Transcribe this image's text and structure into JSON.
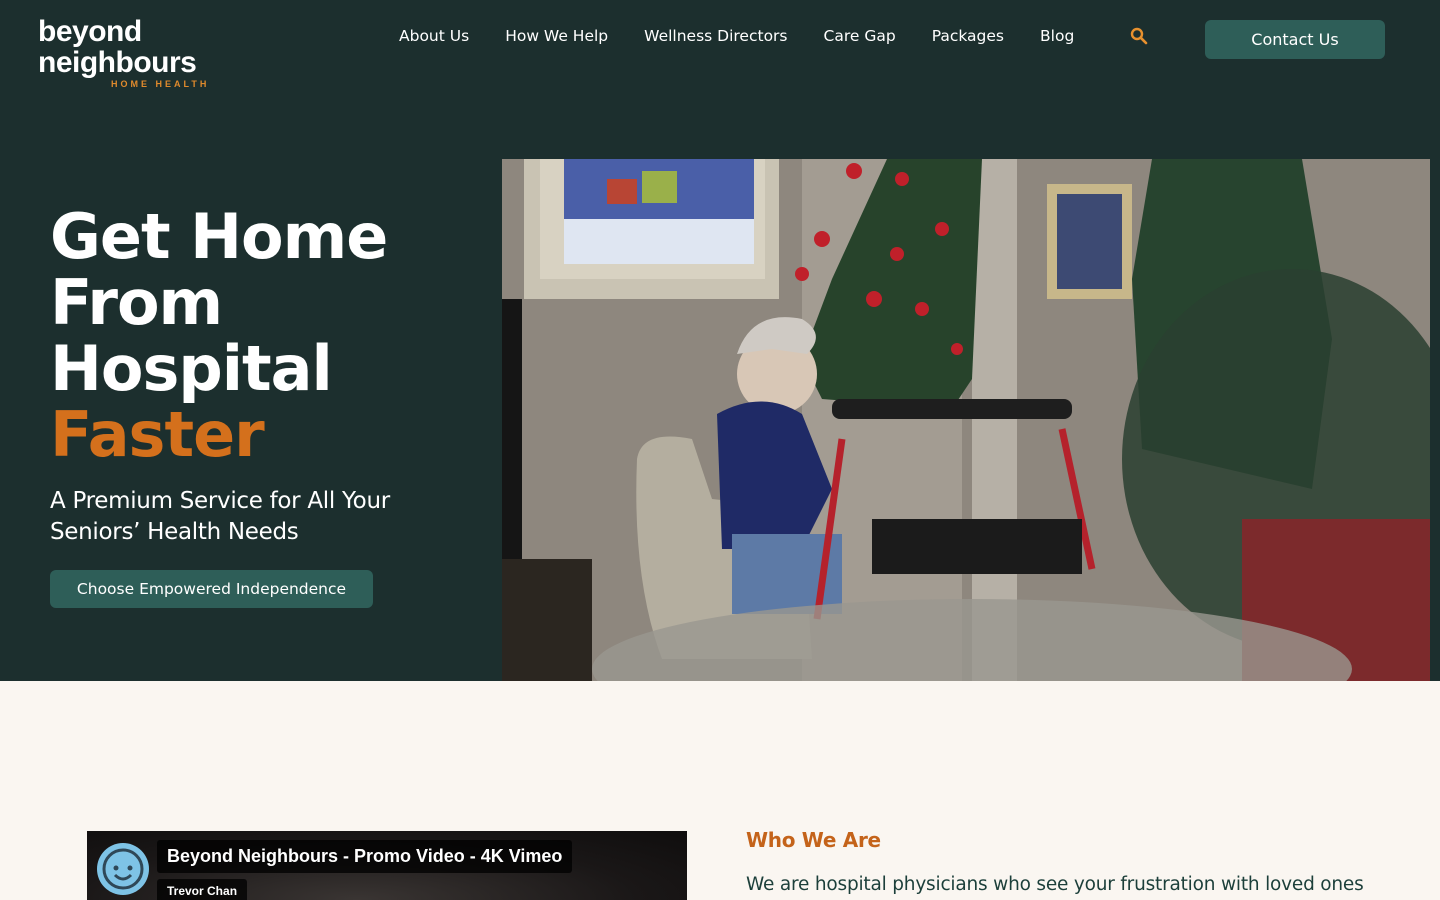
{
  "brand": {
    "line1": "beyond",
    "line2": "neighbours",
    "tagline": "HOME HEALTH",
    "colors": {
      "dark_green": "#1c2f2e",
      "teal_button": "#2e5e58",
      "orange": "#d4701c",
      "cream": "#faf6f1"
    }
  },
  "nav": {
    "items": [
      {
        "label": "About Us"
      },
      {
        "label": "How We Help"
      },
      {
        "label": "Wellness Directors"
      },
      {
        "label": "Care Gap"
      },
      {
        "label": "Packages"
      },
      {
        "label": "Blog"
      }
    ],
    "search_icon": "search-icon",
    "contact_label": "Contact Us"
  },
  "hero": {
    "heading_lines": [
      "Get Home",
      "From",
      "Hospital"
    ],
    "heading_accent": "Faster",
    "subheading": "A Premium Service for All Your Seniors’ Health Needs",
    "cta_label": "Choose Empowered Independence",
    "image_alt": "Senior woman seated in armchair with walker beside a decorated Christmas tree"
  },
  "about": {
    "video": {
      "title": "Beyond Neighbours - Promo Video - 4K Vimeo",
      "author": "Trevor Chan"
    },
    "heading": "Who We Are",
    "text": "We are hospital physicians who see your frustration with loved ones"
  }
}
